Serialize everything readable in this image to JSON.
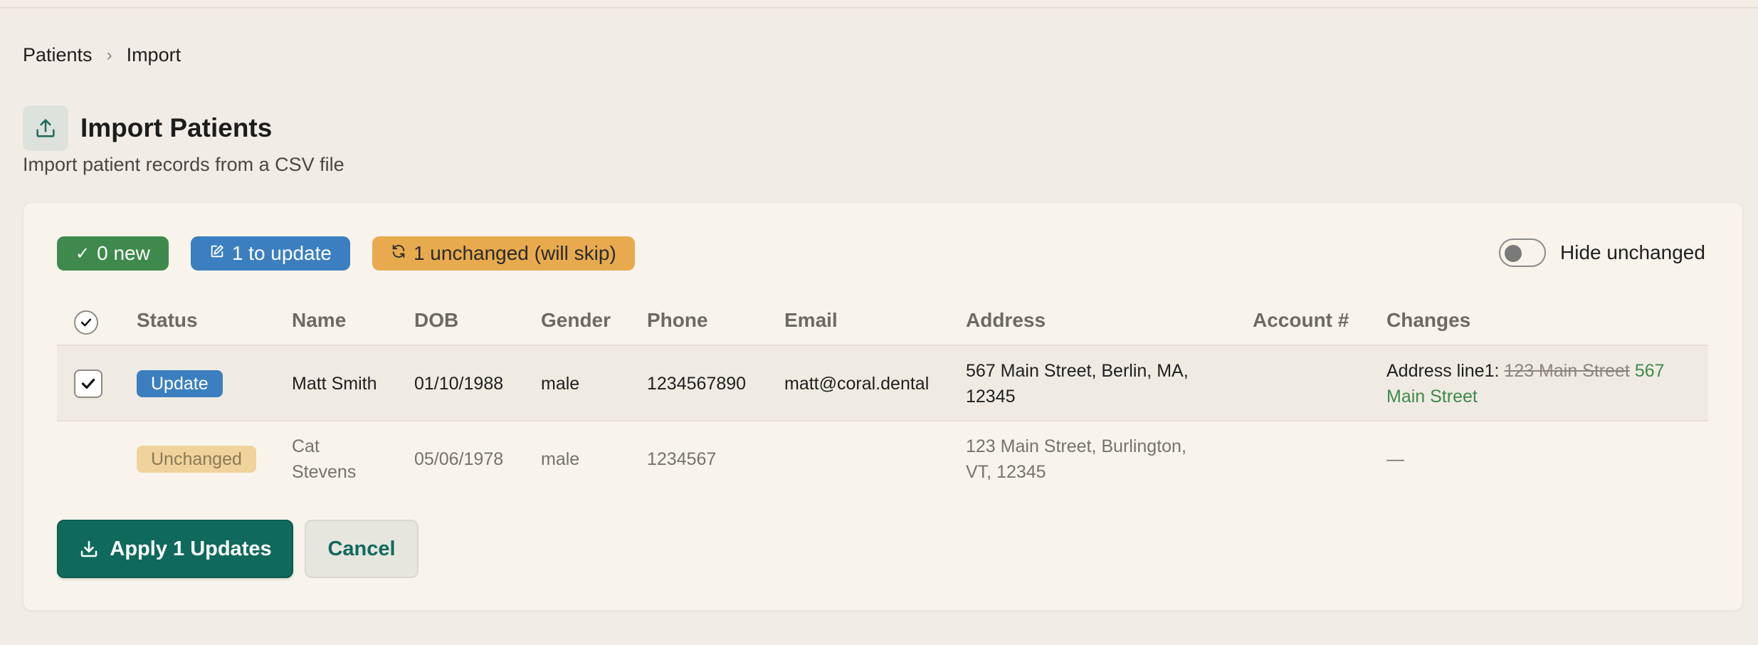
{
  "breadcrumb": {
    "items": [
      "Patients",
      "Import"
    ],
    "separator": "›"
  },
  "header": {
    "title": "Import Patients",
    "subtitle": "Import patient records from a CSV file",
    "icon": "upload-icon"
  },
  "summary": {
    "new_label": "0 new",
    "update_label": "1 to update",
    "unchanged_label": "1 unchanged (will skip)",
    "hide_unchanged_label": "Hide unchanged",
    "hide_unchanged_on": false
  },
  "table": {
    "columns": [
      "Status",
      "Name",
      "DOB",
      "Gender",
      "Phone",
      "Email",
      "Address",
      "Account #",
      "Changes"
    ],
    "rows": [
      {
        "selected": true,
        "status": "Update",
        "name": "Matt Smith",
        "dob": "01/10/1988",
        "gender": "male",
        "phone": "1234567890",
        "email": "matt@coral.dental",
        "address_line1": "567 Main Street, Berlin, MA,",
        "address_line2": "12345",
        "account": "",
        "changes_label": "Address line1:",
        "changes_old": "123 Main Street",
        "changes_new_part1": "567",
        "changes_new_part2": "Main Street"
      },
      {
        "selected": false,
        "status": "Unchanged",
        "name_line1": "Cat",
        "name_line2": "Stevens",
        "dob": "05/06/1978",
        "gender": "male",
        "phone": "1234567",
        "email": "",
        "address_line1": "123 Main Street, Burlington,",
        "address_line2": "VT, 12345",
        "account": "",
        "changes": "—"
      }
    ]
  },
  "actions": {
    "apply_label": "Apply 1 Updates",
    "cancel_label": "Cancel"
  },
  "colors": {
    "primary": "#0f6a5d",
    "new": "#3e8a4c",
    "update": "#3c7fc0",
    "unchanged": "#e8aa4e"
  }
}
